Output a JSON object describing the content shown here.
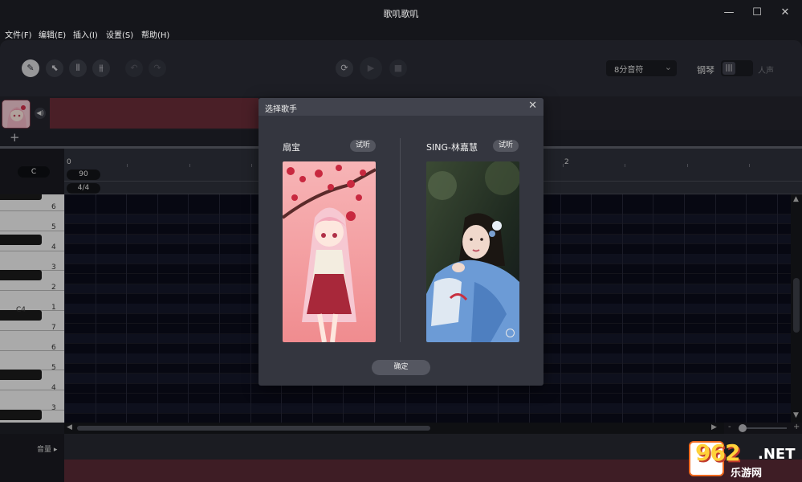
{
  "window": {
    "title": "歌叽歌叽",
    "minimize": "—",
    "maximize": "☐",
    "close": "✕"
  },
  "menu": [
    "文件(F)",
    "编辑(E)",
    "插入(I)",
    "设置(S)",
    "帮助(H)"
  ],
  "toolbar": {
    "note_value": "8分音符",
    "instrument_label": "钢琴",
    "voice_label": "人声",
    "icons": [
      "pen-icon",
      "pointer-icon",
      "mixer-icon",
      "equalizer-icon",
      "undo-icon",
      "redo-icon",
      "loop-icon",
      "play-icon",
      "stop-icon"
    ]
  },
  "track": {
    "add_label": "+"
  },
  "ruler": {
    "bar_start": "0",
    "bar_two": "2",
    "tempo": "90",
    "time_signature": "4/4",
    "key": "C"
  },
  "piano": {
    "labels": [
      "6",
      "5",
      "4",
      "3",
      "2",
      "1",
      "7",
      "6",
      "5",
      "4",
      "3"
    ],
    "c4_label": "C4"
  },
  "volume": {
    "label": "音量"
  },
  "zoom": {
    "minus": "-",
    "plus": "+"
  },
  "dialog": {
    "title": "选择歌手",
    "singers": [
      {
        "name": "扇宝",
        "audition": "试听"
      },
      {
        "name": "SING-林嘉慧",
        "audition": "试听"
      }
    ],
    "confirm": "确定"
  },
  "watermark": {
    "number": "962",
    "net": ".NET",
    "site": "乐游网"
  },
  "colors": {
    "accent_track": "#6b2d38",
    "background": "#1f2027",
    "toolbar": "#2a2c35",
    "dialog": "#34363f"
  }
}
